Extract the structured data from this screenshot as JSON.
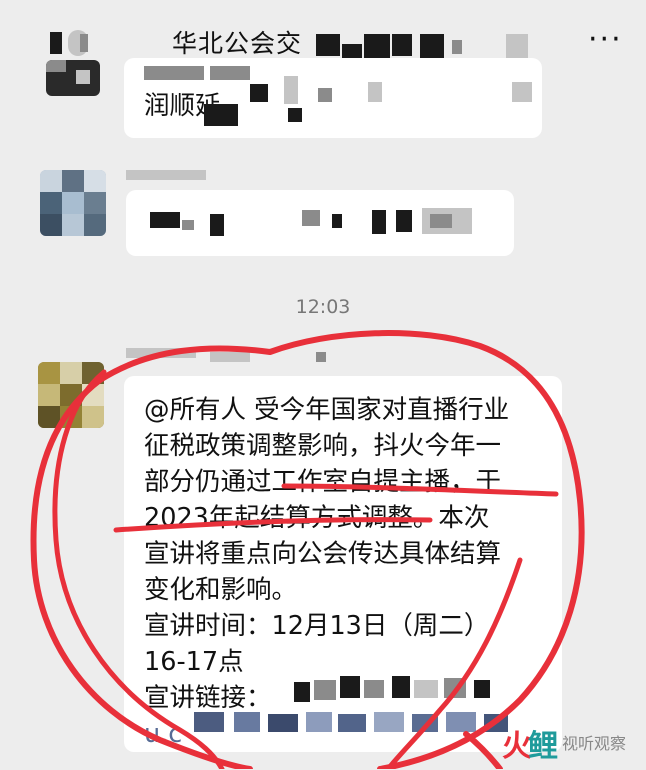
{
  "header": {
    "title": "华北公会交",
    "more_icon_label": "···"
  },
  "messages": [
    {
      "id": "msg1",
      "preview_text": "润顺延"
    },
    {
      "id": "msg2",
      "preview_text": ""
    }
  ],
  "timestamp": "12:03",
  "announcement": {
    "lines": [
      "@所有人 受今年国家对直播行业",
      "征税政策调整影响，抖火今年一",
      "部分仍通过工作室自提主播，于",
      "2023年起结算方式调整。本次",
      "宣讲将重点向公会传达具体结算",
      "变化和影响。",
      "宣讲时间：12月13日（周二）",
      "16-17点",
      "宣讲链接：",
      "u.c"
    ]
  },
  "watermark": {
    "text": "视听观察"
  },
  "colors": {
    "background": "#ededed",
    "bubble": "#ffffff",
    "annotation_red": "#e8303a"
  }
}
